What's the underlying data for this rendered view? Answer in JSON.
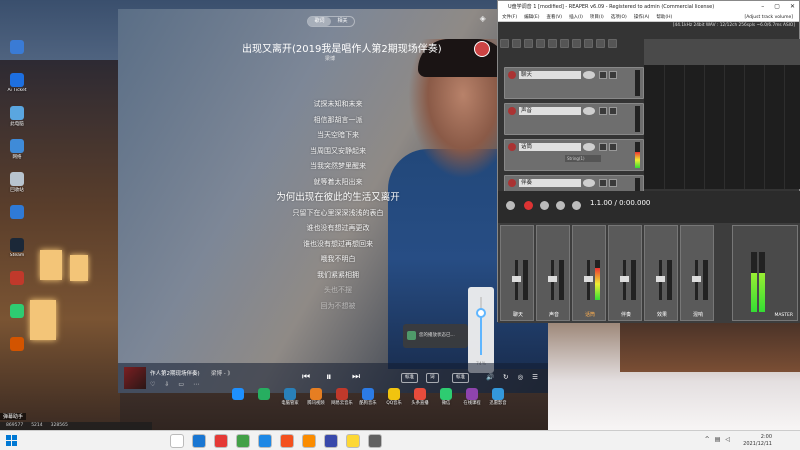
{
  "desktop": {
    "icons": [
      {
        "label": "",
        "color": "#3a7bd5"
      },
      {
        "label": "Ai Ticket",
        "color": "#1d6fe0"
      },
      {
        "label": "此电脑",
        "color": "#5aa6e0"
      },
      {
        "label": "网络",
        "color": "#3f8bd8"
      },
      {
        "label": "回收站",
        "color": "#b8c4cf"
      },
      {
        "label": "",
        "color": "#2f7ad6"
      },
      {
        "label": "Steam",
        "color": "#1b2838"
      },
      {
        "label": "",
        "color": "#c0392b"
      },
      {
        "label": "",
        "color": "#2ecc71"
      },
      {
        "label": "",
        "color": "#d35400"
      }
    ]
  },
  "player": {
    "mode_tabs": [
      "歌词",
      "相关"
    ],
    "active_mode": 0,
    "song_title": "出现又离开(2019我是唱作人第2期现场伴奏)",
    "artist": "梁博",
    "lyrics": [
      {
        "text": "试探未知和未来",
        "state": "normal"
      },
      {
        "text": "相信那胡言一派",
        "state": "normal"
      },
      {
        "text": "当天空暗下来",
        "state": "normal"
      },
      {
        "text": "当周围又安静起来",
        "state": "normal"
      },
      {
        "text": "当我突然梦里醒来",
        "state": "normal"
      },
      {
        "text": "就等着太阳出来",
        "state": "normal"
      },
      {
        "text": "为何出现在彼此的生活又离开",
        "state": "active"
      },
      {
        "text": "只留下在心里深深浅浅的表白",
        "state": "normal"
      },
      {
        "text": "谁也没有想过再更改",
        "state": "normal"
      },
      {
        "text": "谁也没有想过再想回来",
        "state": "normal"
      },
      {
        "text": "哦我不明白",
        "state": "normal"
      },
      {
        "text": "我们紧紧相拥",
        "state": "normal"
      },
      {
        "text": "头也不摆",
        "state": "faded"
      },
      {
        "text": "回为不想被",
        "state": "faded"
      }
    ],
    "bottom": {
      "song": "作人第2期现场伴奏)",
      "singer": "梁博 - 》",
      "chip_quality": "标准",
      "chip_lyric": "词",
      "volume_fraction": 0.72,
      "volume_label": "74%"
    },
    "toast": "您的播放状态已..."
  },
  "reaper": {
    "title": "U盘学调音 1 [modified] - REAPER v6.09 - Registered to admin (Commercial license)",
    "menu": [
      "文件(F)",
      "编辑(E)",
      "查看(V)",
      "插入(I)",
      "项目(I)",
      "选项(O)",
      "操作(A)",
      "帮助(H)",
      "[Adjust track volume]"
    ],
    "status": "[44.1kHz 24bit WAV : 12/12ch 256spls ~6.0/6.7ms ASIO]",
    "tracks": [
      {
        "name": "聊天",
        "level": 0.0,
        "sub": ""
      },
      {
        "name": "声音",
        "level": 0.0,
        "sub": ""
      },
      {
        "name": "话筒",
        "level": 0.6,
        "sub": "String(1)"
      },
      {
        "name": "伴奏",
        "level": 0.0,
        "sub": ""
      }
    ],
    "time": "1.1.00 / 0:00.000",
    "strips": [
      {
        "name": "聊天",
        "level": 0.0,
        "selected": false
      },
      {
        "name": "声音",
        "level": 0.0,
        "selected": false
      },
      {
        "name": "话筒",
        "level": 0.8,
        "selected": true
      },
      {
        "name": "伴奏",
        "level": 0.0,
        "selected": false
      },
      {
        "name": "效果",
        "level": 0.0,
        "selected": false
      },
      {
        "name": "混响",
        "level": 0.0,
        "selected": false
      }
    ],
    "master_label": "MASTER",
    "master_level": 0.65
  },
  "app_row": [
    {
      "label": "",
      "color": "#1e90ff"
    },
    {
      "label": "",
      "color": "#27ae60"
    },
    {
      "label": "电脑管家",
      "color": "#2980b9"
    },
    {
      "label": "腾讯视频",
      "color": "#e67e22"
    },
    {
      "label": "网易云音乐",
      "color": "#c0392b"
    },
    {
      "label": "酷狗音乐",
      "color": "#2c7be5"
    },
    {
      "label": "QQ音乐",
      "color": "#f1c40f"
    },
    {
      "label": "头条直播",
      "color": "#e74c3c"
    },
    {
      "label": "微信",
      "color": "#2ecc71"
    },
    {
      "label": "在线课程",
      "color": "#8e44ad"
    },
    {
      "label": "迅雷影音",
      "color": "#3498db"
    }
  ],
  "stats": {
    "label": "弹幕助手",
    "values": [
      "869577",
      "5214",
      "328565"
    ]
  },
  "taskbar": {
    "icons": [
      "#ffffff",
      "#1976d2",
      "#e53935",
      "#43a047",
      "#1e88e5",
      "#f4511e",
      "#fb8c00",
      "#3949ab",
      "#fdd835",
      "#616161"
    ],
    "time": "2:00",
    "date": "2021/12/11"
  }
}
